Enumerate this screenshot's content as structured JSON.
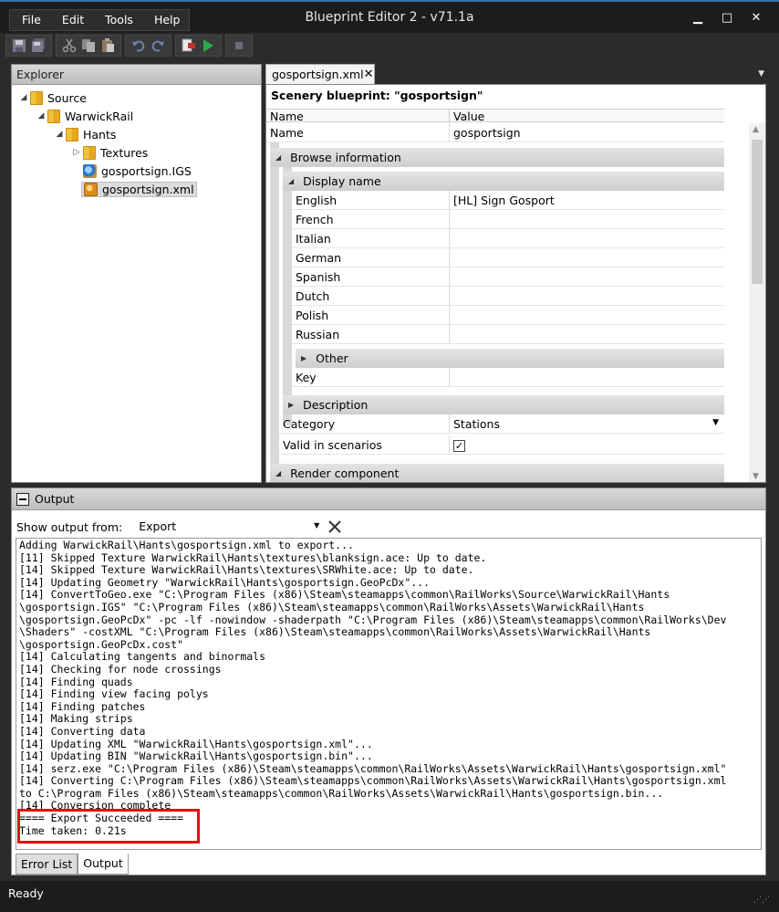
{
  "window": {
    "title": "Blueprint Editor 2 - v71.1a",
    "minimize": "▁",
    "maximize": "□",
    "close": "✕"
  },
  "menu": [
    "File",
    "Edit",
    "Tools",
    "Help"
  ],
  "toolbar": {
    "icons": [
      "save-icon",
      "save-all-icon",
      "cut-icon",
      "copy-icon",
      "paste-icon",
      "undo-icon",
      "redo-icon",
      "export-icon",
      "run-icon",
      "stop-icon"
    ]
  },
  "explorer": {
    "title": "Explorer",
    "tree": [
      {
        "label": "Source",
        "level": 0,
        "type": "folder",
        "expanded": true
      },
      {
        "label": "WarwickRail",
        "level": 1,
        "type": "folder",
        "expanded": true
      },
      {
        "label": "Hants",
        "level": 2,
        "type": "folder",
        "expanded": true
      },
      {
        "label": "Textures",
        "level": 3,
        "type": "folder",
        "expanded": false
      },
      {
        "label": "gosportsign.IGS",
        "level": 3,
        "type": "igs"
      },
      {
        "label": "gosportsign.xml",
        "level": 3,
        "type": "xml",
        "selected": true
      }
    ]
  },
  "editor": {
    "tab_label": "gosportsign.xml",
    "tab_close": "✕",
    "heading": "Scenery blueprint: \"gosportsign\"",
    "columns": {
      "name": "Name",
      "value": "Value"
    },
    "name_row": {
      "name": "Name",
      "value": "gosportsign"
    },
    "browse_information": "Browse information",
    "display_name": "Display name",
    "languages": [
      {
        "name": "English",
        "value": "[HL] Sign Gosport"
      },
      {
        "name": "French",
        "value": ""
      },
      {
        "name": "Italian",
        "value": ""
      },
      {
        "name": "German",
        "value": ""
      },
      {
        "name": "Spanish",
        "value": ""
      },
      {
        "name": "Dutch",
        "value": ""
      },
      {
        "name": "Polish",
        "value": ""
      },
      {
        "name": "Russian",
        "value": ""
      }
    ],
    "other": "Other",
    "key": {
      "name": "Key",
      "value": ""
    },
    "description": "Description",
    "category": {
      "name": "Category",
      "value": "Stations"
    },
    "valid_in_scenarios": {
      "name": "Valid in scenarios",
      "checked": true,
      "mark": "✓"
    },
    "render_component": "Render component"
  },
  "output": {
    "title": "Output",
    "show_output_from_label": "Show output from:",
    "source": "Export",
    "log": [
      "Adding WarwickRail\\Hants\\gosportsign.xml to export...",
      "[11] Skipped Texture WarwickRail\\Hants\\textures\\blanksign.ace: Up to date.",
      "[14] Skipped Texture WarwickRail\\Hants\\textures\\SRWhite.ace: Up to date.",
      "[14] Updating Geometry \"WarwickRail\\Hants\\gosportsign.GeoPcDx\"...",
      "[14] ConvertToGeo.exe \"C:\\Program Files (x86)\\Steam\\steamapps\\common\\RailWorks\\Source\\WarwickRail\\Hants",
      "\\gosportsign.IGS\" \"C:\\Program Files (x86)\\Steam\\steamapps\\common\\RailWorks\\Assets\\WarwickRail\\Hants",
      "\\gosportsign.GeoPcDx\" -pc -lf -nowindow -shaderpath \"C:\\Program Files (x86)\\Steam\\steamapps\\common\\RailWorks\\Dev",
      "\\Shaders\" -costXML \"C:\\Program Files (x86)\\Steam\\steamapps\\common\\RailWorks\\Assets\\WarwickRail\\Hants",
      "\\gosportsign.GeoPcDx.cost\"",
      "[14] Calculating tangents and binormals",
      "[14] Checking for node crossings",
      "[14] Finding quads",
      "[14] Finding view facing polys",
      "[14] Finding patches",
      "[14] Making strips",
      "[14] Converting data",
      "[14] Updating XML \"WarwickRail\\Hants\\gosportsign.xml\"...",
      "[14] Updating BIN \"WarwickRail\\Hants\\gosportsign.bin\"...",
      "[14] serz.exe \"C:\\Program Files (x86)\\Steam\\steamapps\\common\\RailWorks\\Assets\\WarwickRail\\Hants\\gosportsign.xml\"",
      "[14] Converting C:\\Program Files (x86)\\Steam\\steamapps\\common\\RailWorks\\Assets\\WarwickRail\\Hants\\gosportsign.xml",
      "to C:\\Program Files (x86)\\Steam\\steamapps\\common\\RailWorks\\Assets\\WarwickRail\\Hants\\gosportsign.bin...",
      "[14] Conversion complete",
      "==== Export Succeeded ====",
      "Time taken: 0.21s"
    ],
    "tabs": [
      "Error List",
      "Output"
    ],
    "active_tab": "Output"
  },
  "status": {
    "text": "Ready"
  },
  "colors": {
    "highlight": "#d11111",
    "chrome": "#1c1c1c"
  }
}
